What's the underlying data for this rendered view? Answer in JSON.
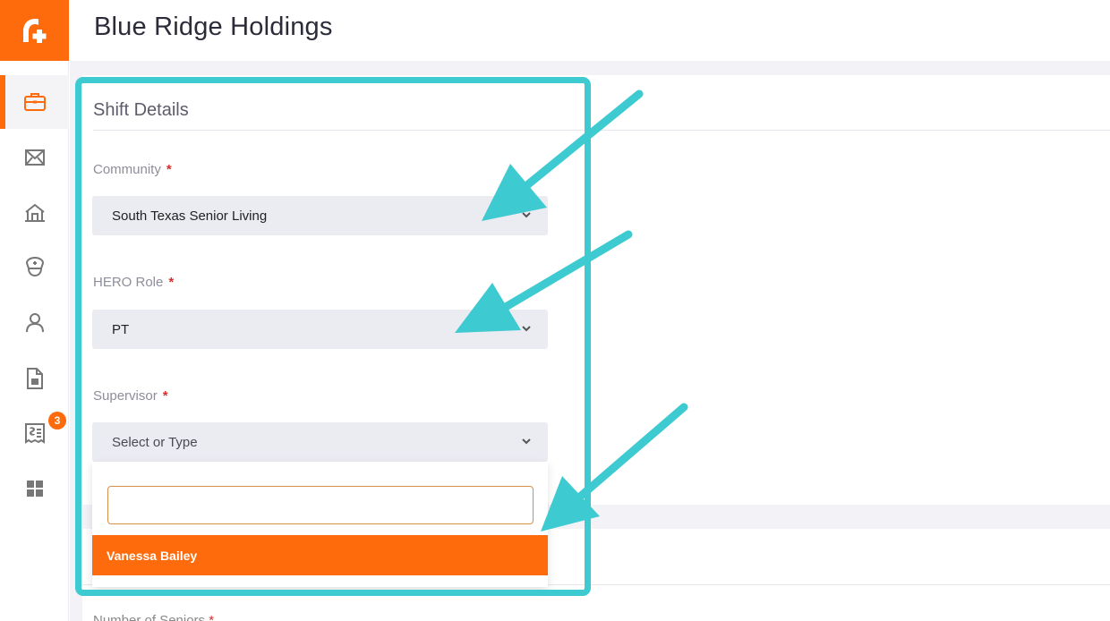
{
  "header": {
    "title": "Blue Ridge Holdings"
  },
  "sidebar": {
    "logo_icon": "plus-a-logo-icon",
    "items": [
      {
        "icon": "briefcase-icon",
        "active": true
      },
      {
        "icon": "mail-icon",
        "active": false
      },
      {
        "icon": "home-icon",
        "active": false
      },
      {
        "icon": "nurse-cap-icon",
        "active": false
      },
      {
        "icon": "user-icon",
        "active": false
      },
      {
        "icon": "document-icon",
        "active": false
      },
      {
        "icon": "receipt-icon",
        "active": false,
        "badge": "3"
      },
      {
        "icon": "grid-icon",
        "active": false
      }
    ]
  },
  "form": {
    "section_title": "Shift Details",
    "required_marker": "*",
    "community": {
      "label": "Community",
      "value": "South Texas Senior Living"
    },
    "hero_role": {
      "label": "HERO Role",
      "value": "PT"
    },
    "supervisor": {
      "label": "Supervisor",
      "placeholder": "Select or Type",
      "search_value": "",
      "options": [
        "Vanessa Bailey"
      ]
    },
    "cut_off_label": "Number of Seniors"
  },
  "colors": {
    "accent": "#fe6b0c",
    "highlight": "#3dcad0",
    "field_bg": "#ebebf2",
    "page_bg": "#f2f2f7"
  }
}
